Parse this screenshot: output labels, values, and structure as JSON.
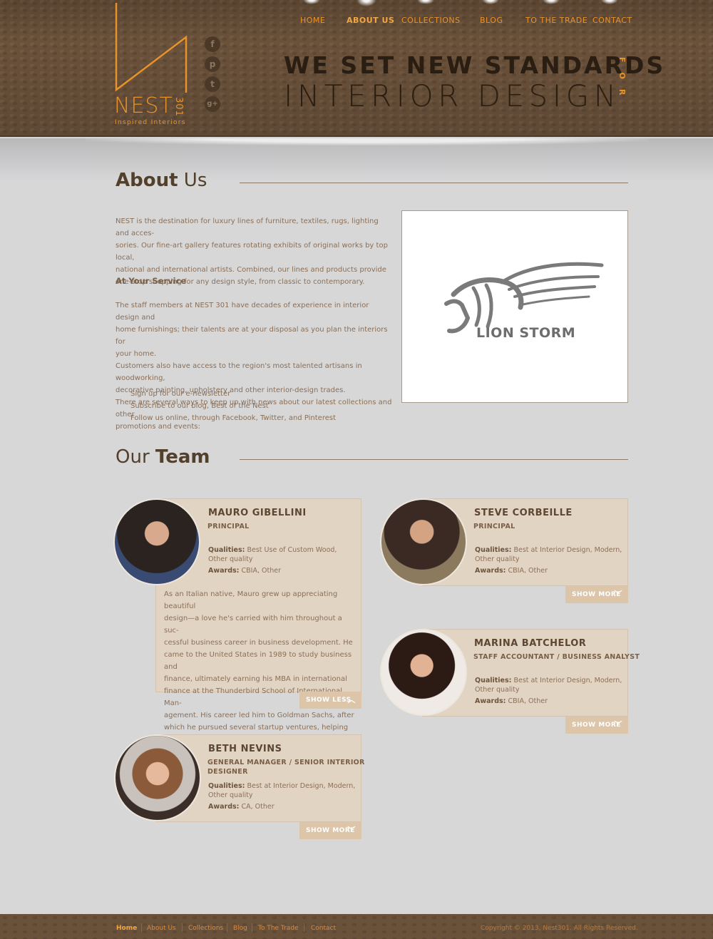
{
  "brand": {
    "name": "NEST",
    "number": "301",
    "tagline": "Inspired Interiors"
  },
  "social": [
    {
      "icon": "facebook-icon",
      "glyph": "f"
    },
    {
      "icon": "pinterest-icon",
      "glyph": "p"
    },
    {
      "icon": "twitter-icon",
      "glyph": "t"
    },
    {
      "icon": "google-plus-icon",
      "glyph": "g+"
    }
  ],
  "nav": [
    "HOME",
    "ABOUT US",
    "COLLECTIONS",
    "BLOG",
    "TO THE TRADE",
    "CONTACT"
  ],
  "hero": {
    "line1": "WE SET NEW STANDARDS",
    "for": "FOR",
    "line2": "INTERIOR DESIGN"
  },
  "about": {
    "title_bold": "About",
    "title_rest": " Us",
    "intro": [
      "NEST is the destination for luxury lines of furniture, textiles, rugs, lighting and acces-",
      "sories. Our fine-art gallery features rotating exhibits of original works by top local,",
      "national and international artists. Combined, our lines and products provide",
      "one-stop shopping for any design style, from classic to contemporary."
    ],
    "service_heading": "At Your Service",
    "service": [
      "The staff members at NEST 301 have decades of experience in interior design and",
      "home furnishings; their talents are at your disposal as you plan the interiors for",
      "your home.",
      "Customers also have access to the region's most talented artisans in woodworking,",
      "decorative painting, upholstery and other interior-design trades.",
      "There are several ways to keep up with news about our latest collections and other",
      "promotions and events:"
    ],
    "list": [
      "Sign up for our e-newsletter",
      "Subscribe to our blog, Best of the Nest",
      "Follow us online, through Facebook, Twitter, and Pinterest"
    ],
    "image_caption": "LION STORM"
  },
  "team": {
    "title_rest": "Our ",
    "title_bold": "Team",
    "members": [
      {
        "name": "MAURO GIBELLINI",
        "role": "PRINCIPAL",
        "qualities_label": "Qualities:",
        "qualities": "Best Use of Custom Wood,",
        "qualities2": "Other quality",
        "awards_label": "Awards:",
        "awards": "CBIA, Other",
        "bio": [
          "As an Italian native, Mauro grew up appreciating beautiful",
          "design—a love he's carried with him throughout a suc-",
          "cessful business career in business development. He",
          "came to the United States in 1989 to study business and",
          "finance, ultimately earning his MBA in international",
          "finance at the Thunderbird School of International Man-",
          "agement. His career led him to Goldman Sachs, after",
          "which he pursued several startup ventures, helping to"
        ],
        "button": "SHOW LESS"
      },
      {
        "name": "STEVE CORBEILLE",
        "role": "PRINCIPAL",
        "qualities_label": "Qualities:",
        "qualities": "Best at Interior Design, Modern,",
        "qualities2": "Other quality",
        "awards_label": "Awards:",
        "awards": "CBIA, Other",
        "button": "SHOW MORE"
      },
      {
        "name": "MARINA BATCHELOR",
        "role": "STAFF ACCOUNTANT / BUSINESS ANALYST",
        "qualities_label": "Qualities:",
        "qualities": "Best at Interior Design, Modern,",
        "qualities2": "Other quality",
        "awards_label": "Awards:",
        "awards": "CBIA, Other",
        "button": "SHOW MORE"
      },
      {
        "name": "BETH NEVINS",
        "role": "GENERAL MANAGER / SENIOR INTERIOR",
        "role2": "DESIGNER",
        "qualities_label": "Qualities:",
        "qualities": "Best at Interior Design, Modern,",
        "qualities2": "Other quality",
        "awards_label": "Awards:",
        "awards": "CA, Other",
        "button": "SHOW MORE"
      }
    ]
  },
  "footer": {
    "links": [
      "Home",
      "About Us",
      "Collections",
      "Blog",
      "To The Trade",
      "Contact"
    ],
    "copyright": "Copyright © 2013, Nest301. All Rights Reserved."
  },
  "colors": {
    "accent": "#e8932a",
    "header_bg": "#6a513a",
    "card_bg": "#e2d4c3",
    "button_bg": "#dcc5a9"
  }
}
